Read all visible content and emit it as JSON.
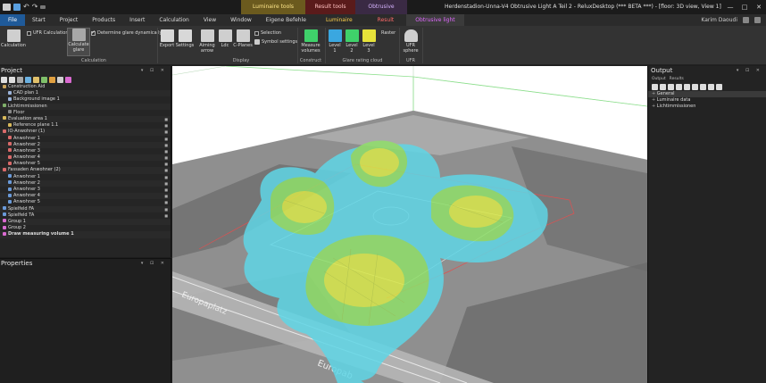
{
  "titlebar": {
    "window_title": "Herdenstadion-Unna-V4 Obtrusive Light A Teil 2 - ReluxDesktop (*** BETA ***) - [floor: 3D view, View 1]",
    "context_tabs": [
      "Luminaire tools",
      "Result tools",
      "Obtrusive light"
    ],
    "controls": [
      "—",
      "□",
      "✕"
    ]
  },
  "menubar": {
    "items": [
      "File",
      "Start",
      "Project",
      "Products",
      "Insert",
      "Calculation",
      "View",
      "Window",
      "Eigene Befehle",
      "Luminaire",
      "Result",
      "Obtrusive light"
    ],
    "user_name": "Karim Daoudi"
  },
  "ribbon": {
    "calculation": "Calculation",
    "ufr_calculation": "UFR Calculation",
    "calculate_glare": "Calculate glare",
    "determine_glare": "Determine glare dynamically",
    "group_calculation": "Calculation",
    "export": "Export",
    "settings": "Settings",
    "aiming_arrow": "Aiming arrow",
    "ldc": "Ldc",
    "c_planes": "C-Planes",
    "selection": "Selection",
    "symbol_settings": "Symbol settings",
    "group_display": "Display",
    "measure_volumes": "Measure volumes",
    "group_construct": "Construct",
    "level1": "Level 1",
    "level2": "Level 2",
    "level3": "Level 3",
    "raster": "Raster",
    "group_glare_cloud": "Glare rating cloud",
    "ufr_sphere": "UFR sphere",
    "group_ufr": "UFR"
  },
  "project": {
    "title": "Project",
    "tree": [
      {
        "label": "Construction Aid",
        "color": "#c9a35a",
        "indent": 0,
        "lock": false
      },
      {
        "label": "CAD plan 1",
        "color": "#9bb3d9",
        "indent": 1,
        "lock": false
      },
      {
        "label": "Background image 1",
        "color": "#9bb3d9",
        "indent": 1,
        "lock": false
      },
      {
        "label": "Lichtimmissionen",
        "color": "#7fb06a",
        "indent": 0,
        "lock": false
      },
      {
        "label": "Floor",
        "color": "#888888",
        "indent": 1,
        "lock": false
      },
      {
        "label": "Evaluation area 1",
        "color": "#d9b95a",
        "indent": 0,
        "lock": true
      },
      {
        "label": "Reference plane 1.1",
        "color": "#d9b95a",
        "indent": 1,
        "lock": true
      },
      {
        "label": "IO-Anwohner (1)",
        "color": "#d96a6a",
        "indent": 0,
        "lock": true
      },
      {
        "label": "Anwohner 1",
        "color": "#d96a6a",
        "indent": 1,
        "lock": true
      },
      {
        "label": "Anwohner 2",
        "color": "#d96a6a",
        "indent": 1,
        "lock": true
      },
      {
        "label": "Anwohner 3",
        "color": "#d96a6a",
        "indent": 1,
        "lock": true
      },
      {
        "label": "Anwohner 4",
        "color": "#d96a6a",
        "indent": 1,
        "lock": true
      },
      {
        "label": "Anwohner 5",
        "color": "#d96a6a",
        "indent": 1,
        "lock": true
      },
      {
        "label": "Fassaden Anwohner (2)",
        "color": "#d96a6a",
        "indent": 0,
        "lock": true
      },
      {
        "label": "Anwohner 1",
        "color": "#6a9ad9",
        "indent": 1,
        "lock": true
      },
      {
        "label": "Anwohner 2",
        "color": "#6a9ad9",
        "indent": 1,
        "lock": true
      },
      {
        "label": "Anwohner 3",
        "color": "#6a9ad9",
        "indent": 1,
        "lock": true
      },
      {
        "label": "Anwohner 4",
        "color": "#6a9ad9",
        "indent": 1,
        "lock": true
      },
      {
        "label": "Anwohner 5",
        "color": "#6a9ad9",
        "indent": 1,
        "lock": true
      },
      {
        "label": "Spielfeld FA",
        "color": "#6a9ad9",
        "indent": 0,
        "lock": true
      },
      {
        "label": "Spielfeld TA",
        "color": "#6a9ad9",
        "indent": 0,
        "lock": true
      },
      {
        "label": "Group 1",
        "color": "#d96ad0",
        "indent": 0,
        "lock": false
      },
      {
        "label": "Group 2",
        "color": "#d96ad0",
        "indent": 0,
        "lock": false
      },
      {
        "label": "Draw measuring volume 1",
        "color": "#d96ad0",
        "indent": 0,
        "lock": false,
        "bold": true
      }
    ]
  },
  "properties": {
    "title": "Properties"
  },
  "output": {
    "title": "Output",
    "tabs": [
      "Output",
      "Results"
    ],
    "rows": [
      "General",
      "Luminaire data",
      "Lichtimmissionen"
    ]
  },
  "viewport": {
    "road_label_1": "Europaplatz",
    "road_label_2": "Europab"
  }
}
